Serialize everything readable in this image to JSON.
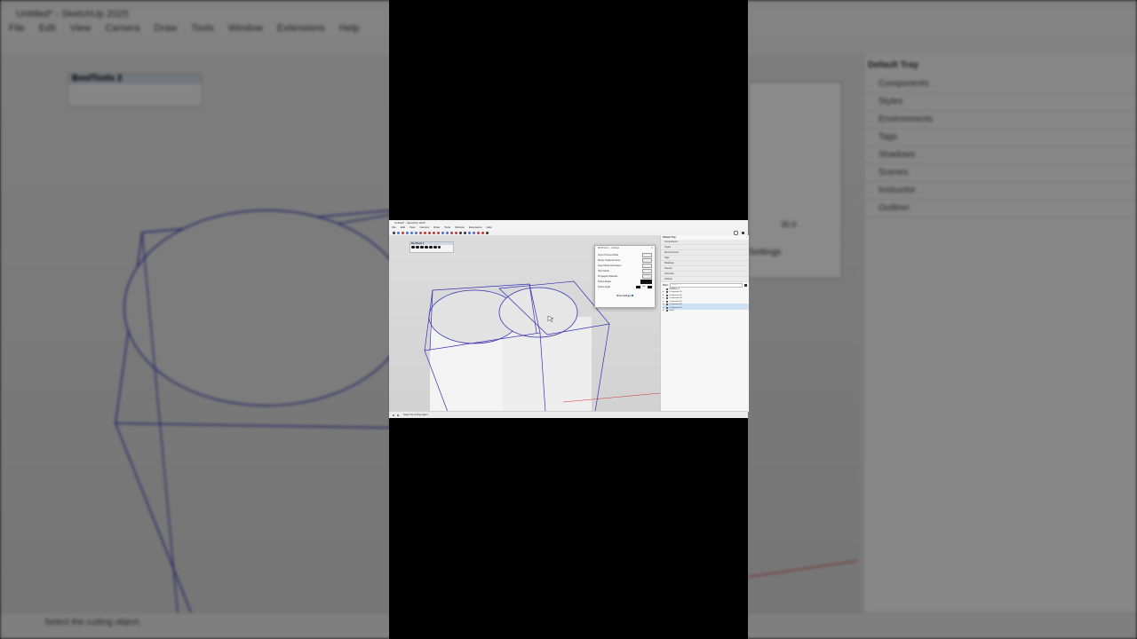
{
  "app": {
    "title": "Untitled* - SketchUp 2025",
    "menu": [
      "File",
      "Edit",
      "View",
      "Camera",
      "Draw",
      "Tools",
      "Window",
      "Extensions",
      "Help"
    ]
  },
  "booltools": {
    "title": "BoolTools 2"
  },
  "tray": {
    "title": "Default Tray",
    "panels": [
      "Components",
      "Styles",
      "Environments",
      "Tags",
      "Shadows",
      "Scenes",
      "Instructor",
      "Outliner"
    ],
    "filter_label": "Filter:",
    "filter_placeholder": "Search",
    "outliner_root": "Untitled_4",
    "outliner_items": [
      "<Component#2>",
      "<Component#3>",
      "<Component#6>",
      "<Component#7>",
      "<Component#8>",
      "<Component#9>",
      "Group"
    ]
  },
  "dialog": {
    "title": "BoolTools 2 - Settings",
    "rows": [
      "Super Preview Mode",
      "Merge Coplanar Faces",
      "Keep Model Information",
      "Hard Solids",
      "Propagate Materials",
      "Soften Edges",
      "Soften Angle"
    ],
    "soften_angle_value": "30.0",
    "show_settings": "Show Settings"
  },
  "background": {
    "settings_fragment": "Settings",
    "angle_value": "30.0"
  },
  "status": {
    "message": "Select the cutting object."
  },
  "colors": {
    "edge_blue": "#3a2fb0",
    "highlight_row": "#cfe2f5",
    "selection_axis_red": "#d03030"
  }
}
